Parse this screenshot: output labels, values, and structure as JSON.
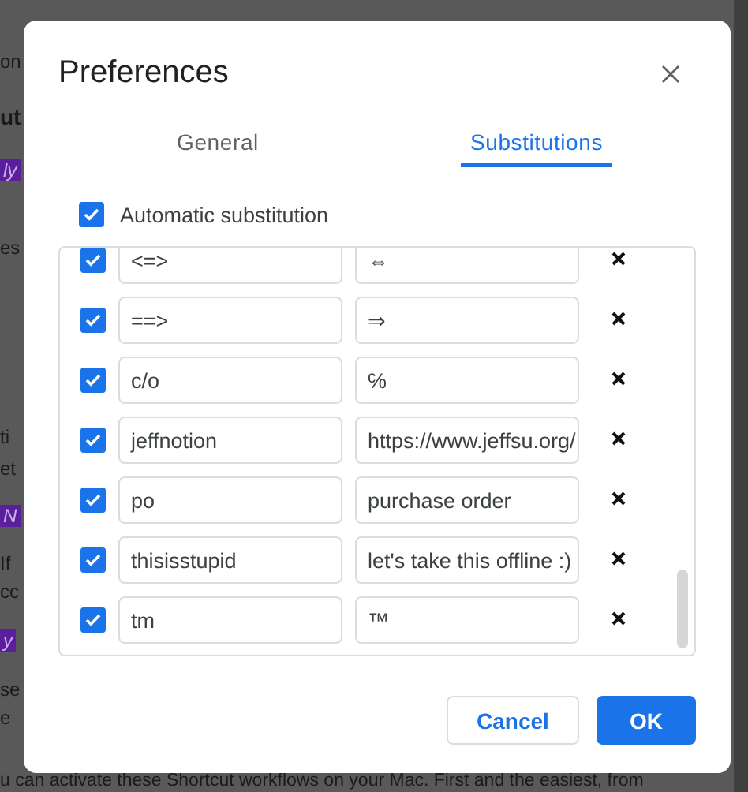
{
  "background": {
    "lines": [
      {
        "text": "on",
        "kind": "plain"
      },
      {
        "text": "ut",
        "kind": "bold"
      },
      {
        "text": "ly",
        "kind": "highlight"
      },
      {
        "text": "es",
        "kind": "plain"
      },
      {
        "text": "ti",
        "kind": "plain"
      },
      {
        "text": "et",
        "kind": "plain"
      },
      {
        "text": "N",
        "kind": "highlight"
      },
      {
        "text": "If",
        "kind": "plain"
      },
      {
        "text": "cc",
        "kind": "plain"
      },
      {
        "text": "y",
        "kind": "highlight"
      },
      {
        "text": "se",
        "kind": "plain"
      },
      {
        "text": "e",
        "kind": "plain"
      },
      {
        "text": "u can activate these Shortcut workflows on your Mac. First and the easiest, from",
        "kind": "plain"
      }
    ]
  },
  "dialog": {
    "title": "Preferences",
    "tabs": [
      {
        "label": "General",
        "selected": false
      },
      {
        "label": "Substitutions",
        "selected": true
      }
    ],
    "automatic_substitution": {
      "label": "Automatic substitution",
      "checked": true
    },
    "substitutions": [
      {
        "replace": "<=>",
        "with": "⇔",
        "checked": true
      },
      {
        "replace": "==>",
        "with": "⇒",
        "checked": true
      },
      {
        "replace": "c/o",
        "with": "℅",
        "checked": true
      },
      {
        "replace": "jeffnotion",
        "with": "https://www.jeffsu.org/",
        "checked": true
      },
      {
        "replace": "po",
        "with": "purchase order",
        "checked": true
      },
      {
        "replace": "thisisstupid",
        "with": "let's take this offline :)",
        "checked": true
      },
      {
        "replace": "tm",
        "with": "™",
        "checked": true
      }
    ],
    "buttons": [
      {
        "label": "Cancel",
        "kind": "secondary"
      },
      {
        "label": "OK",
        "kind": "primary"
      }
    ]
  }
}
